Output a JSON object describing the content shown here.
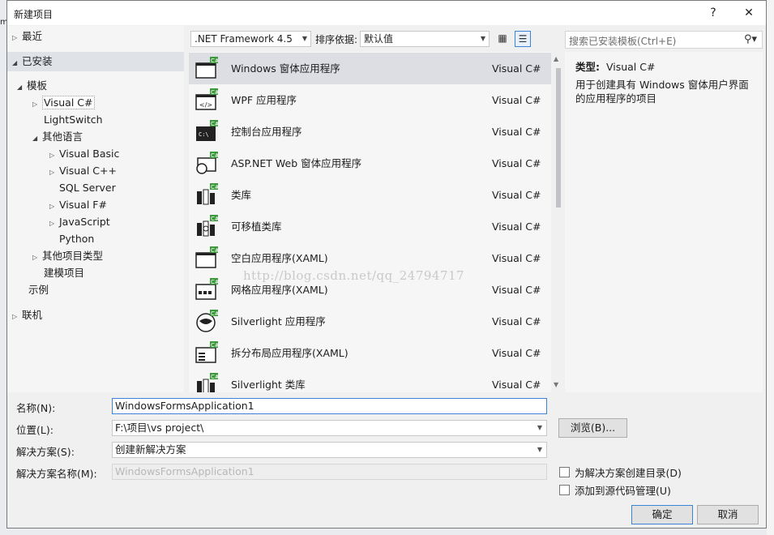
{
  "title": "新建项目",
  "titlebar": {
    "help": "?",
    "close": "✕"
  },
  "tree": {
    "items": [
      {
        "label": "最近",
        "arrow": "▷"
      },
      {
        "label": "已安装",
        "arrow": "◢"
      },
      {
        "label": "模板",
        "arrow": "◢"
      },
      {
        "label": "Visual C#",
        "arrow": "▷"
      },
      {
        "label": "LightSwitch",
        "arrow": ""
      },
      {
        "label": "其他语言",
        "arrow": "◢"
      },
      {
        "label": "Visual Basic",
        "arrow": "▷"
      },
      {
        "label": "Visual C++",
        "arrow": "▷"
      },
      {
        "label": "SQL Server",
        "arrow": ""
      },
      {
        "label": "Visual F#",
        "arrow": "▷"
      },
      {
        "label": "JavaScript",
        "arrow": "▷"
      },
      {
        "label": "Python",
        "arrow": ""
      },
      {
        "label": "其他项目类型",
        "arrow": "▷"
      },
      {
        "label": "建模项目",
        "arrow": ""
      },
      {
        "label": "示例",
        "arrow": ""
      },
      {
        "label": "联机",
        "arrow": "▷"
      }
    ]
  },
  "toolbar": {
    "framework": ".NET Framework 4.5",
    "sort_label": "排序依据:",
    "sort_value": "默认值"
  },
  "templates": [
    {
      "name": "Windows 窗体应用程序",
      "lang": "Visual C#",
      "icon": "windows-form-icon"
    },
    {
      "name": "WPF 应用程序",
      "lang": "Visual C#",
      "icon": "wpf-icon"
    },
    {
      "name": "控制台应用程序",
      "lang": "Visual C#",
      "icon": "console-icon"
    },
    {
      "name": "ASP.NET Web 窗体应用程序",
      "lang": "Visual C#",
      "icon": "aspnet-icon"
    },
    {
      "name": "类库",
      "lang": "Visual C#",
      "icon": "class-library-icon"
    },
    {
      "name": "可移植类库",
      "lang": "Visual C#",
      "icon": "portable-library-icon"
    },
    {
      "name": "空白应用程序(XAML)",
      "lang": "Visual C#",
      "icon": "blank-app-icon"
    },
    {
      "name": "网格应用程序(XAML)",
      "lang": "Visual C#",
      "icon": "grid-app-icon"
    },
    {
      "name": "Silverlight 应用程序",
      "lang": "Visual C#",
      "icon": "silverlight-icon"
    },
    {
      "name": "拆分布局应用程序(XAML)",
      "lang": "Visual C#",
      "icon": "split-app-icon"
    },
    {
      "name": "Silverlight 类库",
      "lang": "Visual C#",
      "icon": "silverlight-library-icon"
    }
  ],
  "watermark": "http://blog.csdn.net/qq_24794717",
  "search": {
    "placeholder": "搜索已安装模板(Ctrl+E)"
  },
  "info": {
    "type_label": "类型:",
    "type_value": "Visual C#",
    "description": "用于创建具有 Windows 窗体用户界面的应用程序的项目"
  },
  "form": {
    "name_label": "名称(N):",
    "name_value": "WindowsFormsApplication1",
    "location_label": "位置(L):",
    "location_value": "F:\\项目\\vs project\\",
    "solution_label": "解决方案(S):",
    "solution_value": "创建新解决方案",
    "solution_name_label": "解决方案名称(M):",
    "solution_name_value": "WindowsFormsApplication1",
    "browse": "浏览(B)...",
    "create_dir": "为解决方案创建目录(D)",
    "add_source": "添加到源代码管理(U)",
    "ok": "确定",
    "cancel": "取消"
  },
  "colors": {
    "selection": "#dcdee3",
    "accent": "#3a85d8",
    "dialog_bg": "#f0f0f0"
  }
}
